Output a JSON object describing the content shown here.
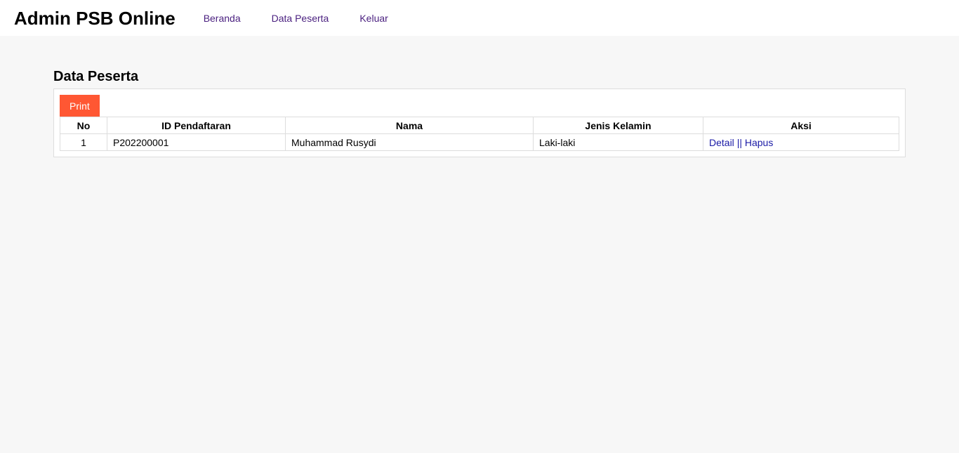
{
  "header": {
    "title": "Admin PSB Online",
    "nav": [
      "Beranda",
      "Data Peserta",
      "Keluar"
    ]
  },
  "main": {
    "title": "Data Peserta",
    "print_label": "Print",
    "table": {
      "headers": [
        "No",
        "ID Pendaftaran",
        "Nama",
        "Jenis Kelamin",
        "Aksi"
      ],
      "rows": [
        {
          "no": "1",
          "id": "P202200001",
          "nama": "Muhammad Rusydi",
          "jenis_kelamin": "Laki-laki",
          "detail_label": "Detail",
          "separator": "||",
          "hapus_label": "Hapus"
        }
      ]
    }
  },
  "colors": {
    "print_button": "#ff5733",
    "nav_link": "#4b2180",
    "action_link": "#1a1aa6",
    "page_background": "#f7f7f7"
  }
}
